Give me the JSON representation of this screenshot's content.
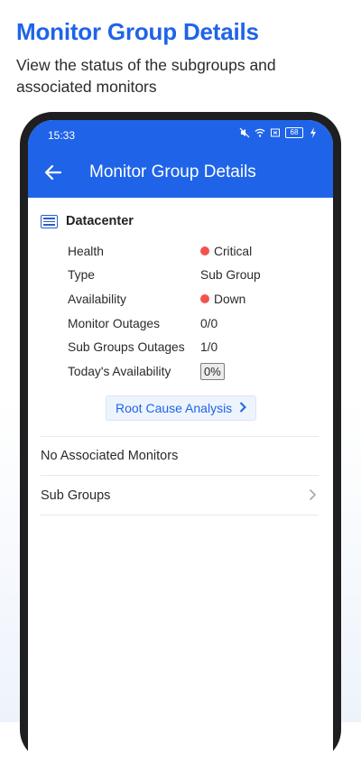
{
  "promo": {
    "title": "Monitor Group Details",
    "subtitle": "View the status of the subgroups and associated monitors"
  },
  "statusbar": {
    "time": "15:33",
    "battery": "68"
  },
  "appbar": {
    "title": "Monitor Group Details"
  },
  "group": {
    "name": "Datacenter",
    "details": [
      {
        "label": "Health",
        "value": "Critical",
        "status": "critical"
      },
      {
        "label": "Type",
        "value": "Sub Group"
      },
      {
        "label": "Availability",
        "value": "Down",
        "status": "down"
      },
      {
        "label": "Monitor Outages",
        "value": "0/0"
      },
      {
        "label": "Sub Groups Outages",
        "value": "1/0"
      },
      {
        "label": "Today's Availability",
        "value": "0%"
      }
    ]
  },
  "rca_button": "Root Cause Analysis",
  "rows": {
    "associated_monitors": "No Associated Monitors",
    "sub_groups": "Sub Groups"
  },
  "colors": {
    "brand": "#1f64e8",
    "critical": "#f0544f"
  },
  "icons": [
    "back-arrow-icon",
    "list-icon",
    "chevron-right-icon",
    "wifi-icon",
    "mute-icon",
    "battery-icon"
  ]
}
